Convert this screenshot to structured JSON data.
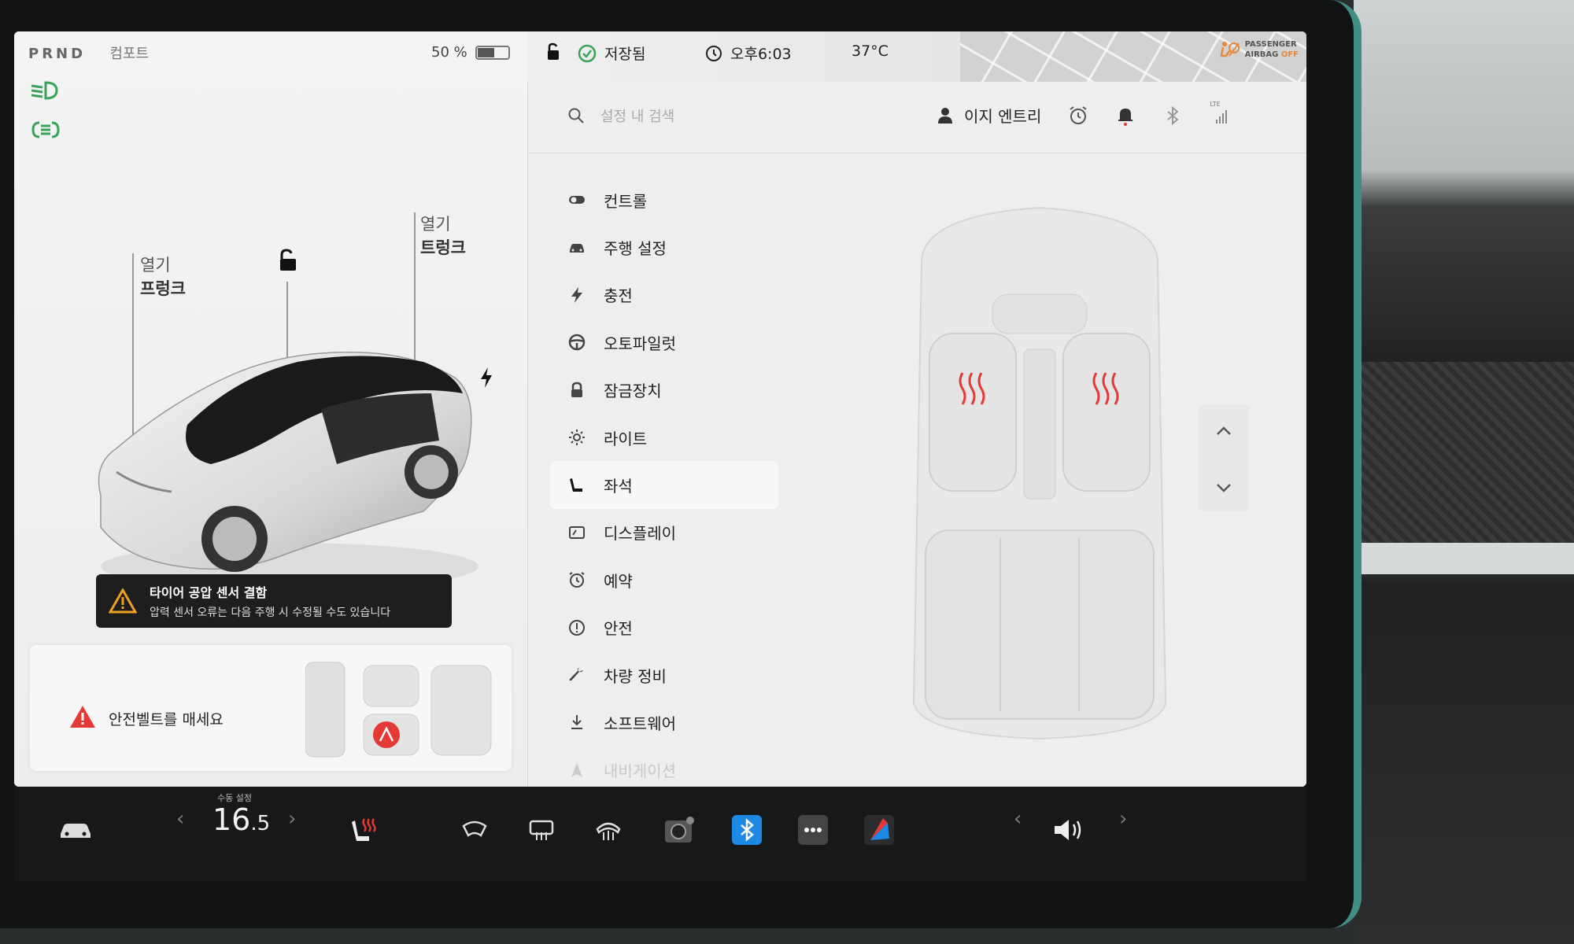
{
  "status": {
    "gear": "PRND",
    "drive_mode": "컴포트",
    "battery_percent_text": "50 %",
    "battery_level": 0.5,
    "saved_label": "저장됨",
    "time": "오후6:03",
    "outside_temp": "37°C",
    "airbag_line1": "PASSENGER",
    "airbag_line2": "AIRBAG",
    "airbag_state": "OFF"
  },
  "vehicle": {
    "frunk_action": "열기",
    "frunk_label": "프렁크",
    "trunk_action": "열기",
    "trunk_label": "트렁크"
  },
  "alerts": {
    "tpms_title": "타이어 공압 센서 결함",
    "tpms_detail": "압력 센서 오류는 다음 주행 시 수정될 수도 있습니다",
    "seatbelt": "안전벨트를 매세요"
  },
  "settings": {
    "search_placeholder": "설정 내 검색",
    "profile_name": "이지 엔트리",
    "lte_label": "LTE",
    "menu": [
      {
        "label": "컨트롤",
        "icon": "toggle-icon"
      },
      {
        "label": "주행 설정",
        "icon": "car-icon"
      },
      {
        "label": "충전",
        "icon": "bolt-icon"
      },
      {
        "label": "오토파일럿",
        "icon": "steering-wheel-icon"
      },
      {
        "label": "잠금장치",
        "icon": "lock-icon"
      },
      {
        "label": "라이트",
        "icon": "sun-icon"
      },
      {
        "label": "좌석",
        "icon": "seat-icon"
      },
      {
        "label": "디스플레이",
        "icon": "display-icon"
      },
      {
        "label": "예약",
        "icon": "alarm-icon"
      },
      {
        "label": "안전",
        "icon": "info-icon"
      },
      {
        "label": "차량 정비",
        "icon": "wrench-icon"
      },
      {
        "label": "소프트웨어",
        "icon": "download-icon"
      },
      {
        "label": "내비게이션",
        "icon": "navigation-icon"
      }
    ],
    "active_index": 6
  },
  "dock": {
    "temp_label": "수동 설정",
    "temp_integer": "16",
    "temp_decimal": ".5"
  },
  "colors": {
    "heat_red": "#e53935",
    "bluetooth_blue": "#1e88e5",
    "airbag_orange": "#e8883a",
    "light_green": "#3aa35a"
  }
}
